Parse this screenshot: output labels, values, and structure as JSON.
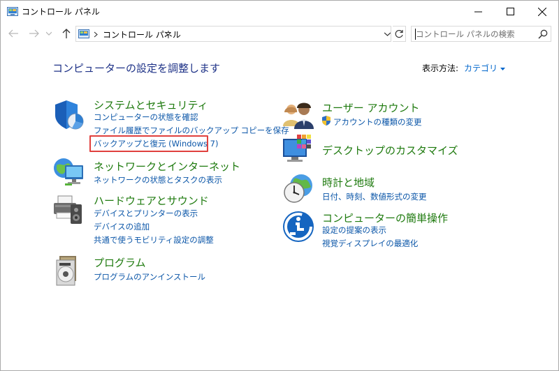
{
  "window": {
    "title": "コントロール パネル"
  },
  "navbar": {
    "breadcrumb": "コントロール パネル",
    "search_placeholder": "コントロール パネルの検索"
  },
  "main": {
    "heading": "コンピューターの設定を調整します",
    "view_by_label": "表示方法:",
    "view_by_value": "カテゴリ"
  },
  "categories": {
    "system": {
      "title": "システムとセキュリティ",
      "links": [
        "コンピューターの状態を確認",
        "ファイル履歴でファイルのバックアップ コピーを保存",
        "バックアップと復元 (Windows 7)"
      ]
    },
    "network": {
      "title": "ネットワークとインターネット",
      "links": [
        "ネットワークの状態とタスクの表示"
      ]
    },
    "hardware": {
      "title": "ハードウェアとサウンド",
      "links": [
        "デバイスとプリンターの表示",
        "デバイスの追加",
        "共通で使うモビリティ設定の調整"
      ]
    },
    "programs": {
      "title": "プログラム",
      "links": [
        "プログラムのアンインストール"
      ]
    },
    "users": {
      "title": "ユーザー アカウント",
      "links": [
        "アカウントの種類の変更"
      ]
    },
    "desktop": {
      "title": "デスクトップのカスタマイズ"
    },
    "clock": {
      "title": "時計と地域",
      "links": [
        "日付、時刻、数値形式の変更"
      ]
    },
    "ease": {
      "title": "コンピューターの簡単操作",
      "links": [
        "設定の提案の表示",
        "視覚ディスプレイの最適化"
      ]
    }
  },
  "colors": {
    "category_title": "#1e7a0e",
    "link": "#0b56a8",
    "heading": "#1e3287",
    "highlight_box": "#e0403d"
  }
}
